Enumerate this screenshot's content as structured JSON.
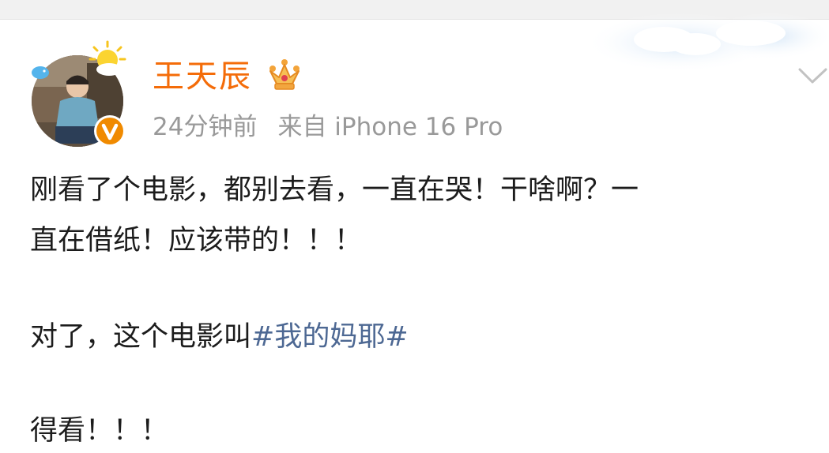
{
  "post": {
    "author": {
      "name": "王天辰"
    },
    "meta": {
      "time": "24分钟前",
      "source": "来自 iPhone 16 Pro"
    },
    "lines": {
      "line1": "刚看了个电影，都别去看，一直在哭！干啥啊？一",
      "line2": "直在借纸！应该带的！！！",
      "line3_prefix": "对了，这个电影叫",
      "line4": "得看！！！"
    },
    "hashtag": "#我的妈耶#"
  },
  "colors": {
    "username": "#f46c09",
    "meta": "#999999",
    "body_text": "#1c1c1c",
    "hashtag": "#4d6893",
    "verified_badge": "#f08a00"
  },
  "icons": {
    "crown": "crown-icon",
    "verified": "verified-v-icon",
    "more": "chevron-down-icon"
  }
}
